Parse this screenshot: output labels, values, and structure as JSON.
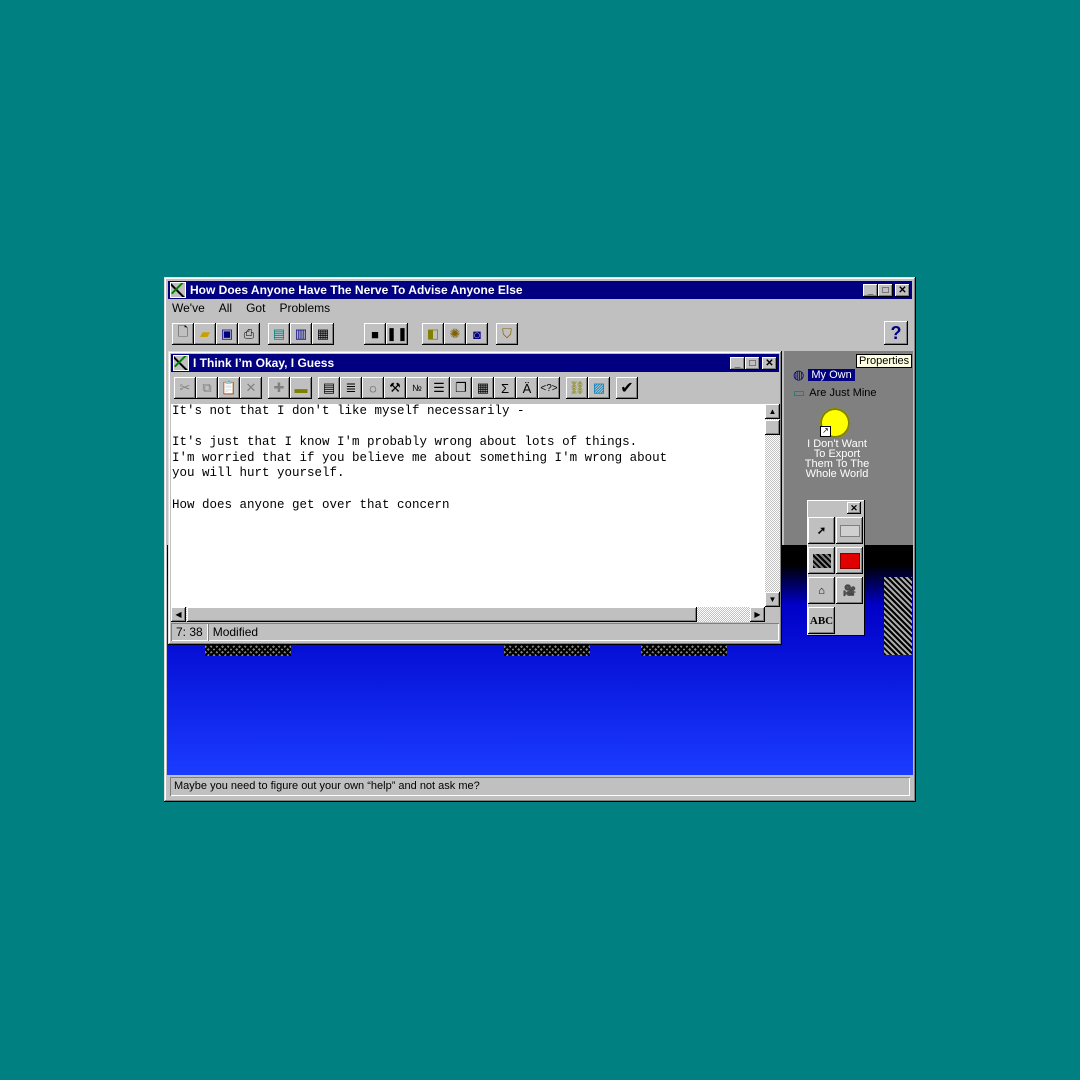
{
  "main_window": {
    "title": "How Does Anyone Have The Nerve To Advise Anyone Else",
    "menu": [
      "We've",
      "All",
      "Got",
      "Problems"
    ],
    "status": "Maybe you need to figure out your own “help” and not ask me?",
    "help_glyph": "?"
  },
  "doc_window": {
    "title": "I Think I’m Okay, I Guess",
    "text": "It's not that I don't like myself necessarily -\n\nIt's just that I know I'm probably wrong about lots of things.\nI'm worried that if you believe me about something I'm wrong about\nyou will hurt yourself.\n\nHow does anyone get over that concern",
    "position": "7: 38",
    "state": "Modified"
  },
  "desktop_icons": {
    "my_own": "My Own",
    "are_just_mine": "Are Just Mine",
    "export_label": "I Don't Want To Export Them To The Whole World"
  },
  "tooltip": "Properties",
  "palette": {
    "text_tool": "ABC"
  },
  "colors": {
    "desktop": "#008080",
    "titlebar": "#000080",
    "face": "#c0c0c0"
  }
}
